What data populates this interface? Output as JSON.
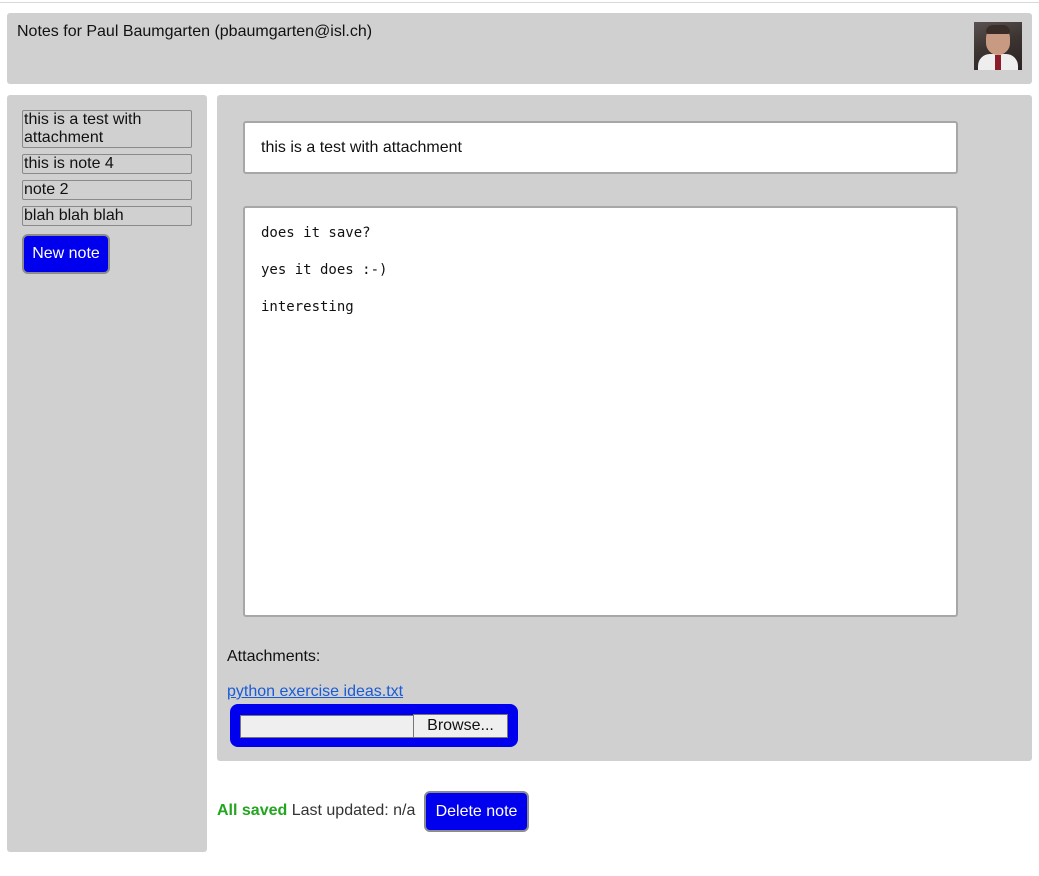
{
  "header": {
    "title": "Notes for Paul Baumgarten (pbaumgarten@isl.ch)",
    "avatar": "user-avatar"
  },
  "sidebar": {
    "notes": [
      {
        "label": "this is a test with attachment"
      },
      {
        "label": "this is note 4"
      },
      {
        "label": "note 2"
      },
      {
        "label": "blah blah blah"
      }
    ],
    "new_note_label": "New note"
  },
  "editor": {
    "title_value": "this is a test with attachment",
    "body_lines": [
      "does it save?",
      "yes it does :-)",
      "interesting"
    ],
    "attachments_label": "Attachments:",
    "attachment_link": "python exercise ideas.txt",
    "browse_label": "Browse..."
  },
  "footer": {
    "saved_text": "All saved",
    "last_updated": "Last updated: n/a",
    "delete_label": "Delete note"
  },
  "colors": {
    "panel": "#d0d0d0",
    "accent_blue": "#0000ee",
    "saved_green": "#22a51f",
    "link": "#1a5bd6"
  }
}
